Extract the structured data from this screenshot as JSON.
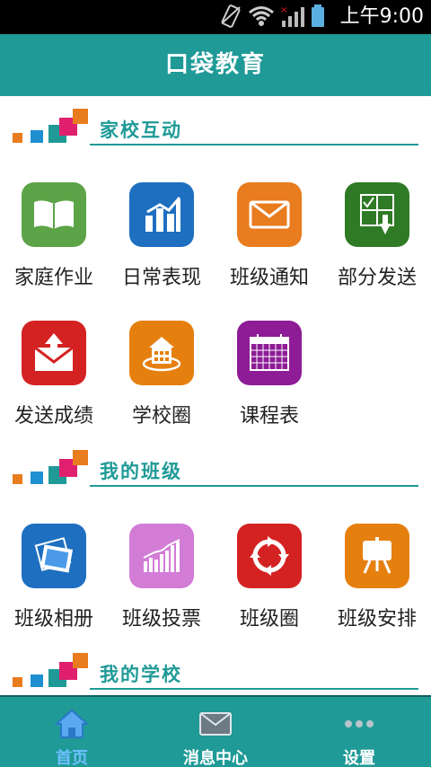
{
  "status_bar": {
    "time": "上午9:00"
  },
  "header": {
    "title": "口袋教育"
  },
  "sections": [
    {
      "title": "家校互动",
      "items": [
        {
          "label": "家庭作业",
          "icon": "book-icon",
          "color": "#5ca447"
        },
        {
          "label": "日常表现",
          "icon": "chart-icon",
          "color": "#1e6fc0"
        },
        {
          "label": "班级通知",
          "icon": "envelope-icon",
          "color": "#e87c1e"
        },
        {
          "label": "部分发送",
          "icon": "checklist-icon",
          "color": "#2f7a25"
        },
        {
          "label": "发送成绩",
          "icon": "mail-upload-icon",
          "color": "#d42222"
        },
        {
          "label": "学校圈",
          "icon": "school-icon",
          "color": "#e5800f"
        },
        {
          "label": "课程表",
          "icon": "calendar-icon",
          "color": "#8d1c96"
        }
      ]
    },
    {
      "title": "我的班级",
      "items": [
        {
          "label": "班级相册",
          "icon": "photos-icon",
          "color": "#1e6fc0"
        },
        {
          "label": "班级投票",
          "icon": "bar-chart-icon",
          "color": "#d27cd6"
        },
        {
          "label": "班级圈",
          "icon": "refresh-icon",
          "color": "#d42222"
        },
        {
          "label": "班级安排",
          "icon": "easel-icon",
          "color": "#e5800f"
        }
      ]
    },
    {
      "title": "我的学校",
      "items": []
    }
  ],
  "bottom_nav": [
    {
      "label": "首页",
      "icon": "home-icon",
      "active": true
    },
    {
      "label": "消息中心",
      "icon": "message-icon",
      "active": false
    },
    {
      "label": "设置",
      "icon": "more-icon",
      "active": false
    }
  ],
  "colors": {
    "primary": "#1f9a97",
    "active_nav": "#6fc0ff"
  }
}
